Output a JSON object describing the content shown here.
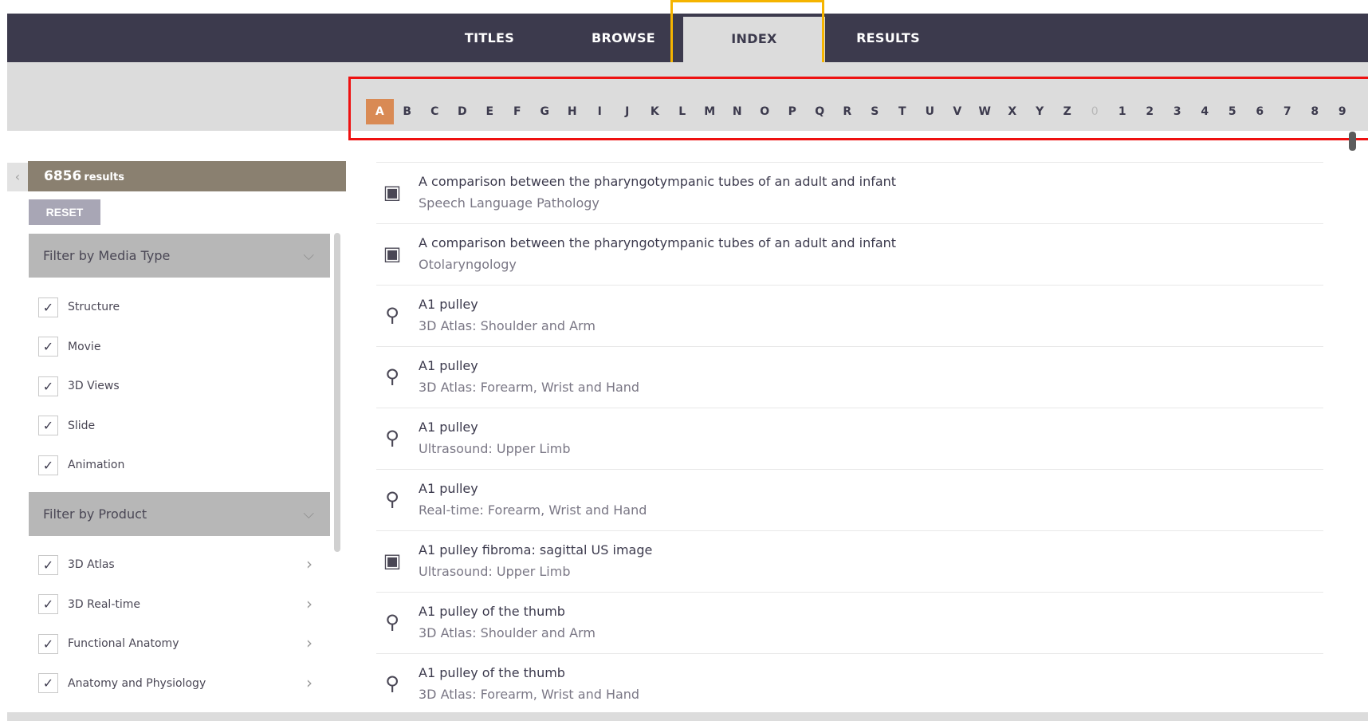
{
  "nav": {
    "tabs": [
      {
        "label": "TITLES"
      },
      {
        "label": "BROWSE"
      },
      {
        "label": "INDEX"
      },
      {
        "label": "RESULTS"
      }
    ],
    "active": "INDEX"
  },
  "alphabet": {
    "letters": [
      "A",
      "B",
      "C",
      "D",
      "E",
      "F",
      "G",
      "H",
      "I",
      "J",
      "K",
      "L",
      "M",
      "N",
      "O",
      "P",
      "Q",
      "R",
      "S",
      "T",
      "U",
      "V",
      "W",
      "X",
      "Y",
      "Z",
      "0",
      "1",
      "2",
      "3",
      "4",
      "5",
      "6",
      "7",
      "8",
      "9"
    ],
    "active": "A",
    "disabled": [
      "0"
    ]
  },
  "sidebar": {
    "collapse_icon": "chevron-left-icon",
    "results_count": "6856",
    "results_word": "results",
    "reset_label": "RESET",
    "media_filter": {
      "title": "Filter by Media Type",
      "options": [
        {
          "label": "Structure",
          "checked": true
        },
        {
          "label": "Movie",
          "checked": true
        },
        {
          "label": "3D Views",
          "checked": true
        },
        {
          "label": "Slide",
          "checked": true
        },
        {
          "label": "Animation",
          "checked": true
        }
      ]
    },
    "product_filter": {
      "title": "Filter by Product",
      "options": [
        {
          "label": "3D Atlas",
          "checked": true
        },
        {
          "label": "3D Real-time",
          "checked": true
        },
        {
          "label": "Functional Anatomy",
          "checked": true
        },
        {
          "label": "Anatomy and Physiology",
          "checked": true
        }
      ]
    }
  },
  "results": [
    {
      "title": "A comparison between the pharyngotympanic tubes of an adult and infant",
      "subtitle": "Speech Language Pathology",
      "icon": "slide-icon"
    },
    {
      "title": "A comparison between the pharyngotympanic tubes of an adult and infant",
      "subtitle": "Otolaryngology",
      "icon": "slide-icon"
    },
    {
      "title": "A1 pulley",
      "subtitle": "3D Atlas: Shoulder and Arm",
      "icon": "structure-icon"
    },
    {
      "title": "A1 pulley",
      "subtitle": "3D Atlas: Forearm, Wrist and Hand",
      "icon": "structure-icon"
    },
    {
      "title": "A1 pulley",
      "subtitle": "Ultrasound: Upper Limb",
      "icon": "structure-icon"
    },
    {
      "title": "A1 pulley",
      "subtitle": "Real-time: Forearm, Wrist and Hand",
      "icon": "structure-icon"
    },
    {
      "title": "A1 pulley fibroma: sagittal US image",
      "subtitle": "Ultrasound: Upper Limb",
      "icon": "slide-icon"
    },
    {
      "title": "A1 pulley of the thumb",
      "subtitle": "3D Atlas: Shoulder and Arm",
      "icon": "structure-icon"
    },
    {
      "title": "A1 pulley of the thumb",
      "subtitle": "3D Atlas: Forearm, Wrist and Hand",
      "icon": "structure-icon"
    }
  ],
  "colors": {
    "navbar": "#3c3a4d",
    "active_letter": "#d98a54",
    "results_bar": "#8a8070",
    "highlight_index": "#f5b400",
    "highlight_alphabet": "#ee1111"
  }
}
